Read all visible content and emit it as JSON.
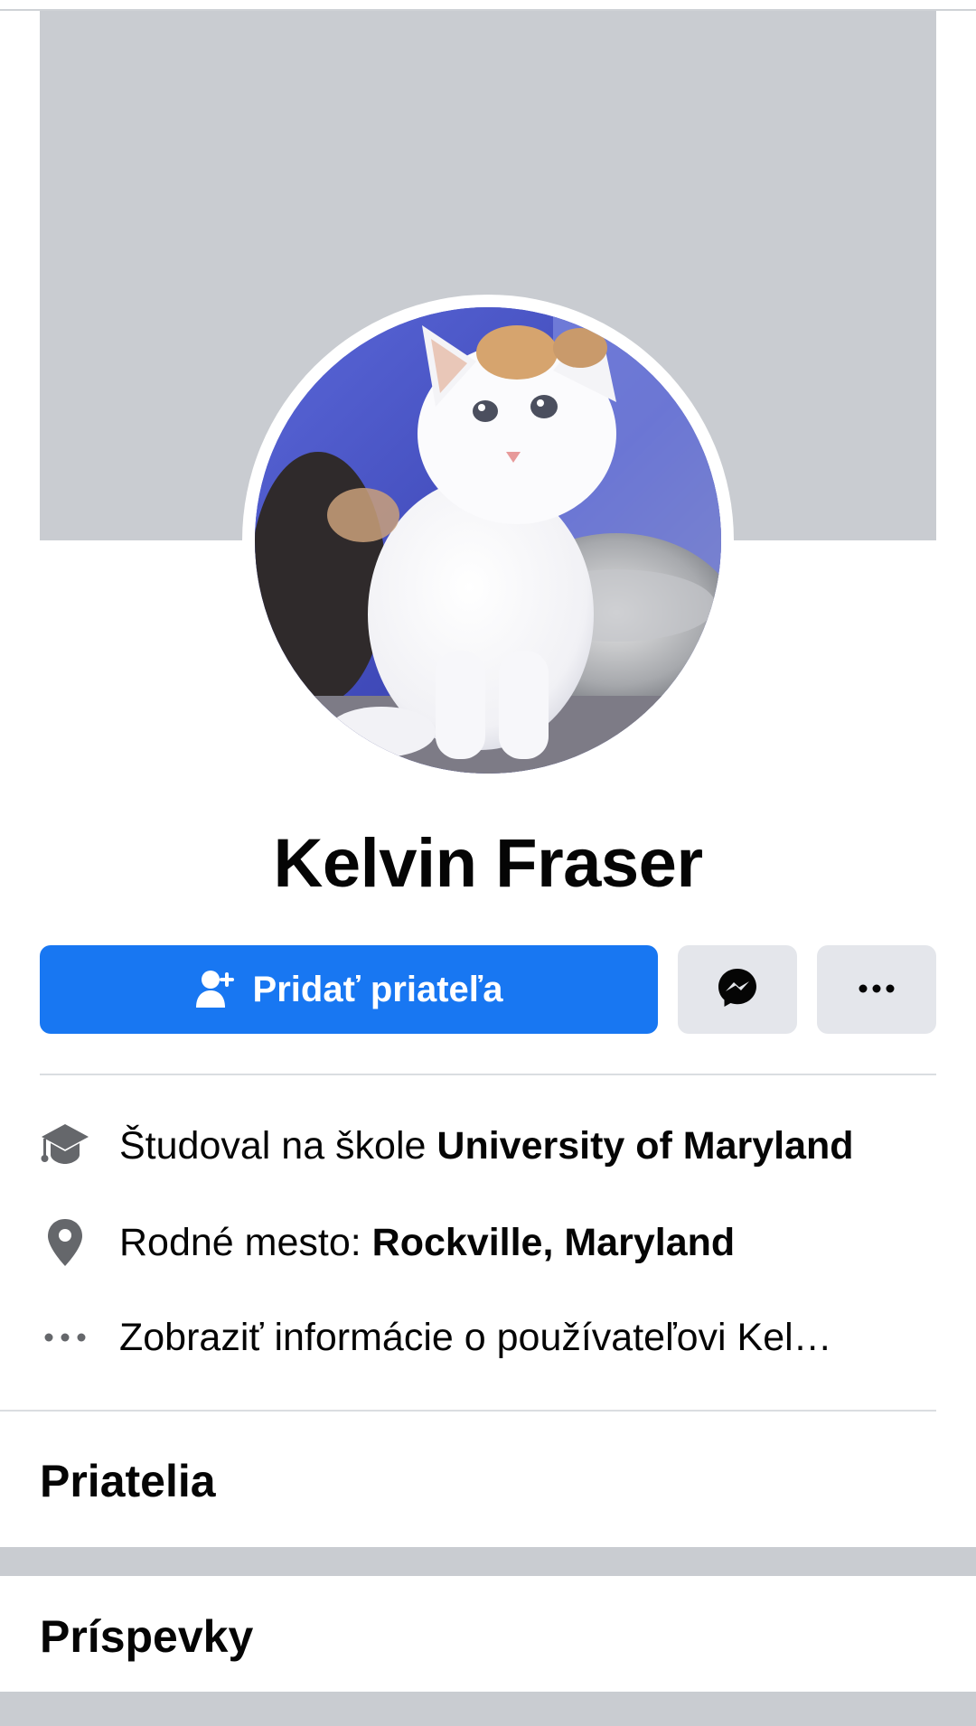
{
  "profile": {
    "name": "Kelvin Fraser",
    "avatar_icon": "cat-profile-photo"
  },
  "actions": {
    "add_friend_label": "Pridať priateľa",
    "add_friend_icon": "add-person-icon",
    "messenger_icon": "messenger-icon",
    "more_icon": "more-dots-icon"
  },
  "about": {
    "studied_prefix": "Študoval na škole ",
    "studied_school": "University of Maryland",
    "hometown_prefix": "Rodné mesto: ",
    "hometown": "Rockville, Maryland",
    "see_about": "Zobraziť informácie o používateľovi Kel…"
  },
  "sections": {
    "friends": "Priatelia",
    "posts": "Príspevky"
  },
  "colors": {
    "primary": "#1877f2",
    "cover": "#c9ccd1",
    "secondary_button": "#e4e6eb"
  }
}
